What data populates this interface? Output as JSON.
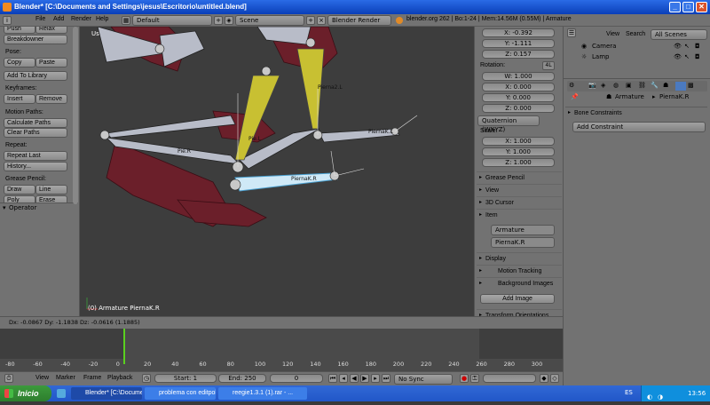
{
  "window": {
    "title": "Blender* [C:\\Documents and Settings\\jesus\\Escritorio\\untitled.blend]",
    "min": "_",
    "max": "□",
    "close": "✕"
  },
  "header": {
    "menus": [
      "File",
      "Add",
      "Render",
      "Help"
    ],
    "layout": "Default",
    "scene": "Scene",
    "engine": "Blender Render",
    "stats": "blender.org 262 | Bo:1-24 | Mem:14.56M (0.55M) | Armature"
  },
  "toolshelf": {
    "top_buttons": [
      "Push",
      "Relax"
    ],
    "breakdowner": "Breakdowner",
    "pose_label": "Pose:",
    "copy": "Copy",
    "paste": "Paste",
    "add_library": "Add To Library",
    "keyframes_label": "Keyframes:",
    "insert": "Insert",
    "remove": "Remove",
    "motion_label": "Motion Paths:",
    "calculate": "Calculate Paths",
    "clear": "Clear Paths",
    "repeat_label": "Repeat:",
    "repeat_last": "Repeat Last",
    "history": "History...",
    "grease_label": "Grease Pencil:",
    "draw": "Draw",
    "line": "Line",
    "poly": "Poly",
    "erase": "Erase",
    "operator": "Operator"
  },
  "viewport": {
    "view_label": "User Ortho",
    "object_label": "(0) Armature PiernaK.R",
    "bone_labels": [
      "Pierna2.L",
      "PiernaK.L",
      "Pie.L",
      "Pie.R",
      "PiernaK.R"
    ]
  },
  "npanel": {
    "location": [
      "X: -0.392",
      "Y: -1.111",
      "Z: 0.157"
    ],
    "rotation_label": "Rotation:",
    "rot_mode_4l": "4L",
    "rotation": [
      "W: 1.000",
      "X: 0.000",
      "Y: 0.000",
      "Z: 0.000"
    ],
    "rotation_mode": "Quaternion (WXYZ)",
    "scale_label": "Scale:",
    "scale": [
      "X: 1.000",
      "Y: 1.000",
      "Z: 1.000"
    ],
    "panels": [
      "Grease Pencil",
      "View",
      "3D Cursor"
    ],
    "item_label": "Item",
    "armature_name": "Armature",
    "bone_name": "PiernaK.R",
    "display": "Display",
    "motion_tracking": "Motion Tracking",
    "background_images": "Background Images",
    "add_image": "Add Image",
    "transform_orientations": "Transform Orientations"
  },
  "footer": {
    "delta": "Dx: -0.0867   Dy: -1.1838   Dz: -0.0616 (1.1885)"
  },
  "timeline": {
    "ticks": [
      "-80",
      "-60",
      "-40",
      "-20",
      "0",
      "20",
      "40",
      "60",
      "80",
      "100",
      "120",
      "140",
      "160",
      "180",
      "200",
      "220",
      "240",
      "260",
      "280",
      "300"
    ],
    "menus": [
      "View",
      "Marker",
      "Frame",
      "Playback"
    ],
    "start": "Start: 1",
    "end": "End: 250",
    "current": "0",
    "sync": "No Sync",
    "playhead_frame": 0
  },
  "outliner": {
    "view": "View",
    "search": "Search",
    "scenes": "All Scenes",
    "items": [
      "Camera",
      "Lamp"
    ]
  },
  "properties": {
    "breadcrumb_armature": "Armature",
    "breadcrumb_bone": "PiernaK.R",
    "bone_constraints": "Bone Constraints",
    "add_constraint": "Add Constraint"
  },
  "taskbar": {
    "start": "Inicio",
    "tasks": [
      "Blender* [C:\\Docume...",
      "problema con editpol...",
      "reegie1.3.1 (1).rar - ..."
    ],
    "lang": "ES",
    "clock": "13:56"
  },
  "colors": {
    "bone_selected": "#cfe9f7",
    "bone_yellow": "#c8c032",
    "mesh": "#6b1f2a",
    "playhead": "#5ad01f"
  }
}
